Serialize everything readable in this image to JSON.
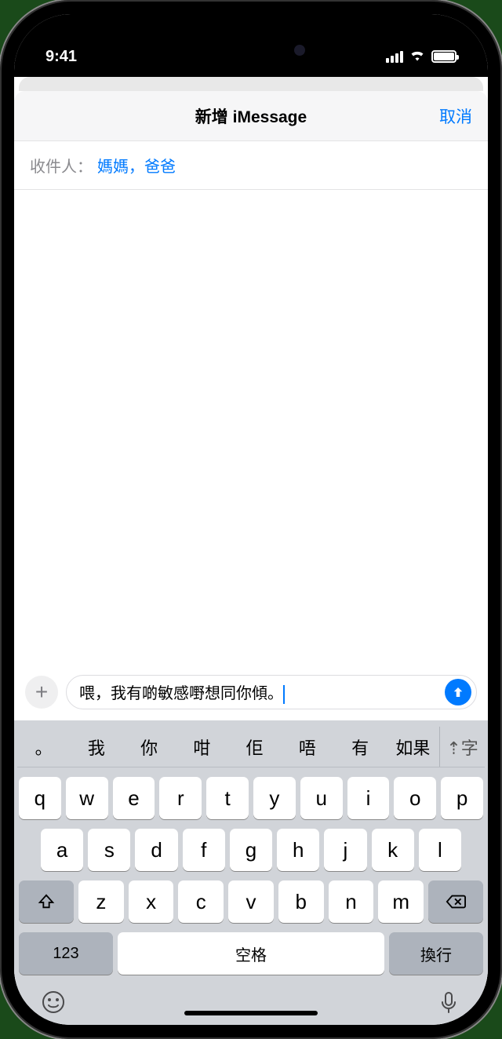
{
  "status": {
    "time": "9:41"
  },
  "header": {
    "title": "新增 iMessage",
    "cancel": "取消"
  },
  "to": {
    "label": "收件人：",
    "recipients": "媽媽，爸爸"
  },
  "compose": {
    "message": "喂，我有啲敏感嘢想同你傾。"
  },
  "candidates": [
    "。",
    "我",
    "你",
    "咁",
    "佢",
    "唔",
    "有",
    "如果"
  ],
  "candidate_toggle": "⇡字",
  "keyboard": {
    "row1": [
      "q",
      "w",
      "e",
      "r",
      "t",
      "y",
      "u",
      "i",
      "o",
      "p"
    ],
    "row2": [
      "a",
      "s",
      "d",
      "f",
      "g",
      "h",
      "j",
      "k",
      "l"
    ],
    "row3": [
      "z",
      "x",
      "c",
      "v",
      "b",
      "n",
      "m"
    ],
    "numbers": "123",
    "space": "空格",
    "return": "換行"
  }
}
